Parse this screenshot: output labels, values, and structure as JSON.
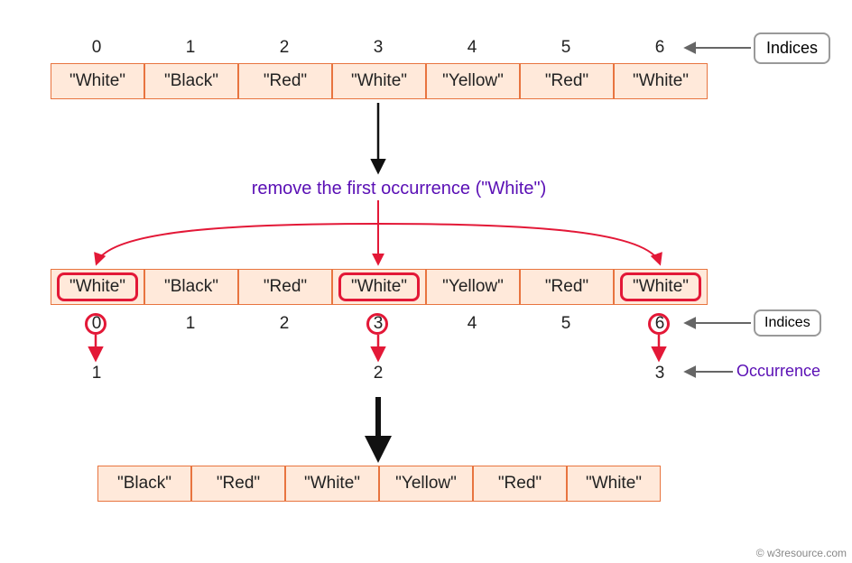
{
  "labels": {
    "indices": "Indices",
    "occurrence": "Occurrence",
    "title": "remove the first occurrence (\"White\")",
    "watermark": "© w3resource.com"
  },
  "highlight_token": "\"White\"",
  "array1": {
    "indices": [
      "0",
      "1",
      "2",
      "3",
      "4",
      "5",
      "6"
    ],
    "cells": [
      "\"White\"",
      "\"Black\"",
      "\"Red\"",
      "\"White\"",
      "\"Yellow\"",
      "\"Red\"",
      "\"White\""
    ]
  },
  "array2": {
    "indices": [
      "0",
      "1",
      "2",
      "3",
      "4",
      "5",
      "6"
    ],
    "cells": [
      "\"White\"",
      "\"Black\"",
      "\"Red\"",
      "\"White\"",
      "\"Yellow\"",
      "\"Red\"",
      "\"White\""
    ],
    "highlight_cells": [
      0,
      3,
      6
    ],
    "highlight_idx": [
      0,
      3,
      6
    ],
    "occurrence": {
      "0": "1",
      "3": "2",
      "6": "3"
    }
  },
  "result": {
    "cells": [
      "\"Black\"",
      "\"Red\"",
      "\"White\"",
      "\"Yellow\"",
      "\"Red\"",
      "\"White\""
    ]
  }
}
